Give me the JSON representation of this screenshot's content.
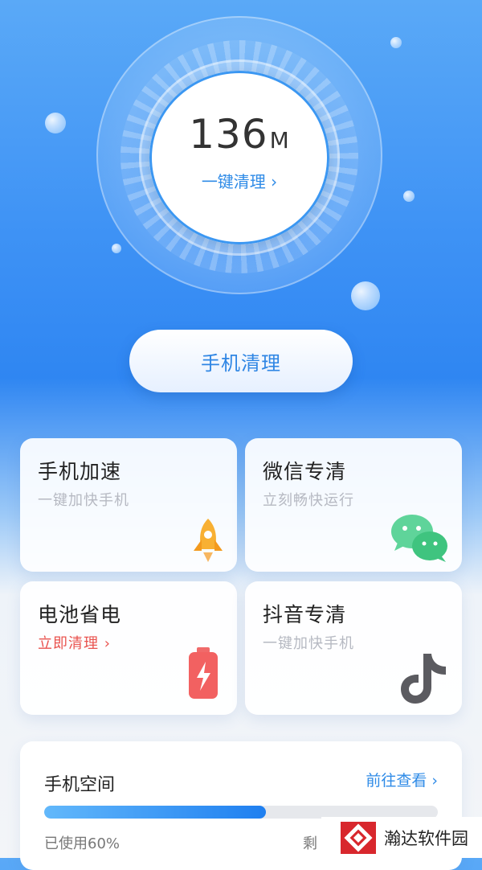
{
  "dial": {
    "size_value": "136",
    "size_unit": "M",
    "action_label": "一键清理 ›"
  },
  "main_button": {
    "label": "手机清理"
  },
  "cards": [
    {
      "title": "手机加速",
      "subtitle": "一键加快手机",
      "icon": "rocket-icon"
    },
    {
      "title": "微信专清",
      "subtitle": "立刻畅快运行",
      "icon": "wechat-icon"
    },
    {
      "title": "电池省电",
      "subtitle": "立即清理 ›",
      "icon": "battery-icon",
      "subtitle_color": "#e9534f"
    },
    {
      "title": "抖音专清",
      "subtitle": "一键加快手机",
      "icon": "tiktok-icon"
    }
  ],
  "storage": {
    "title": "手机空间",
    "link_label": "前往查看 ›",
    "used_label": "已使用60%",
    "used_fraction": 0.6,
    "remaining_label": "剩"
  },
  "watermark": {
    "text": "瀚达软件园"
  },
  "colors": {
    "accent": "#2f86e4",
    "danger": "#e9534f"
  }
}
